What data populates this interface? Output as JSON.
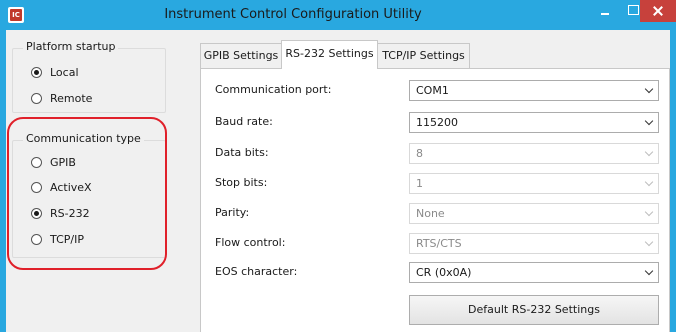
{
  "window": {
    "title": "Instrument Control Configuration Utility"
  },
  "platform_startup": {
    "title": "Platform startup",
    "options": [
      {
        "label": "Local",
        "selected": true
      },
      {
        "label": "Remote",
        "selected": false
      }
    ]
  },
  "communication_type": {
    "title": "Communication type",
    "options": [
      {
        "label": "GPIB",
        "selected": false
      },
      {
        "label": "ActiveX",
        "selected": false
      },
      {
        "label": "RS-232",
        "selected": true
      },
      {
        "label": "TCP/IP",
        "selected": false
      }
    ]
  },
  "tabs": [
    {
      "label": "GPIB Settings",
      "active": false
    },
    {
      "label": "RS-232 Settings",
      "active": true
    },
    {
      "label": "TCP/IP Settings",
      "active": false
    }
  ],
  "settings": [
    {
      "label": "Communication port:",
      "value": "COM1",
      "enabled": true
    },
    {
      "label": "Baud rate:",
      "value": "115200",
      "enabled": true
    },
    {
      "label": "Data bits:",
      "value": "8",
      "enabled": false
    },
    {
      "label": "Stop bits:",
      "value": "1",
      "enabled": false
    },
    {
      "label": "Parity:",
      "value": "None",
      "enabled": false
    },
    {
      "label": "Flow control:",
      "value": "RTS/CTS",
      "enabled": false
    },
    {
      "label": "EOS character:",
      "value": "CR (0x0A)",
      "enabled": true
    }
  ],
  "default_button": "Default RS-232 Settings",
  "colors": {
    "titlebar": "#29a8e0",
    "close": "#c7413c",
    "highlight": "#e0202a"
  }
}
